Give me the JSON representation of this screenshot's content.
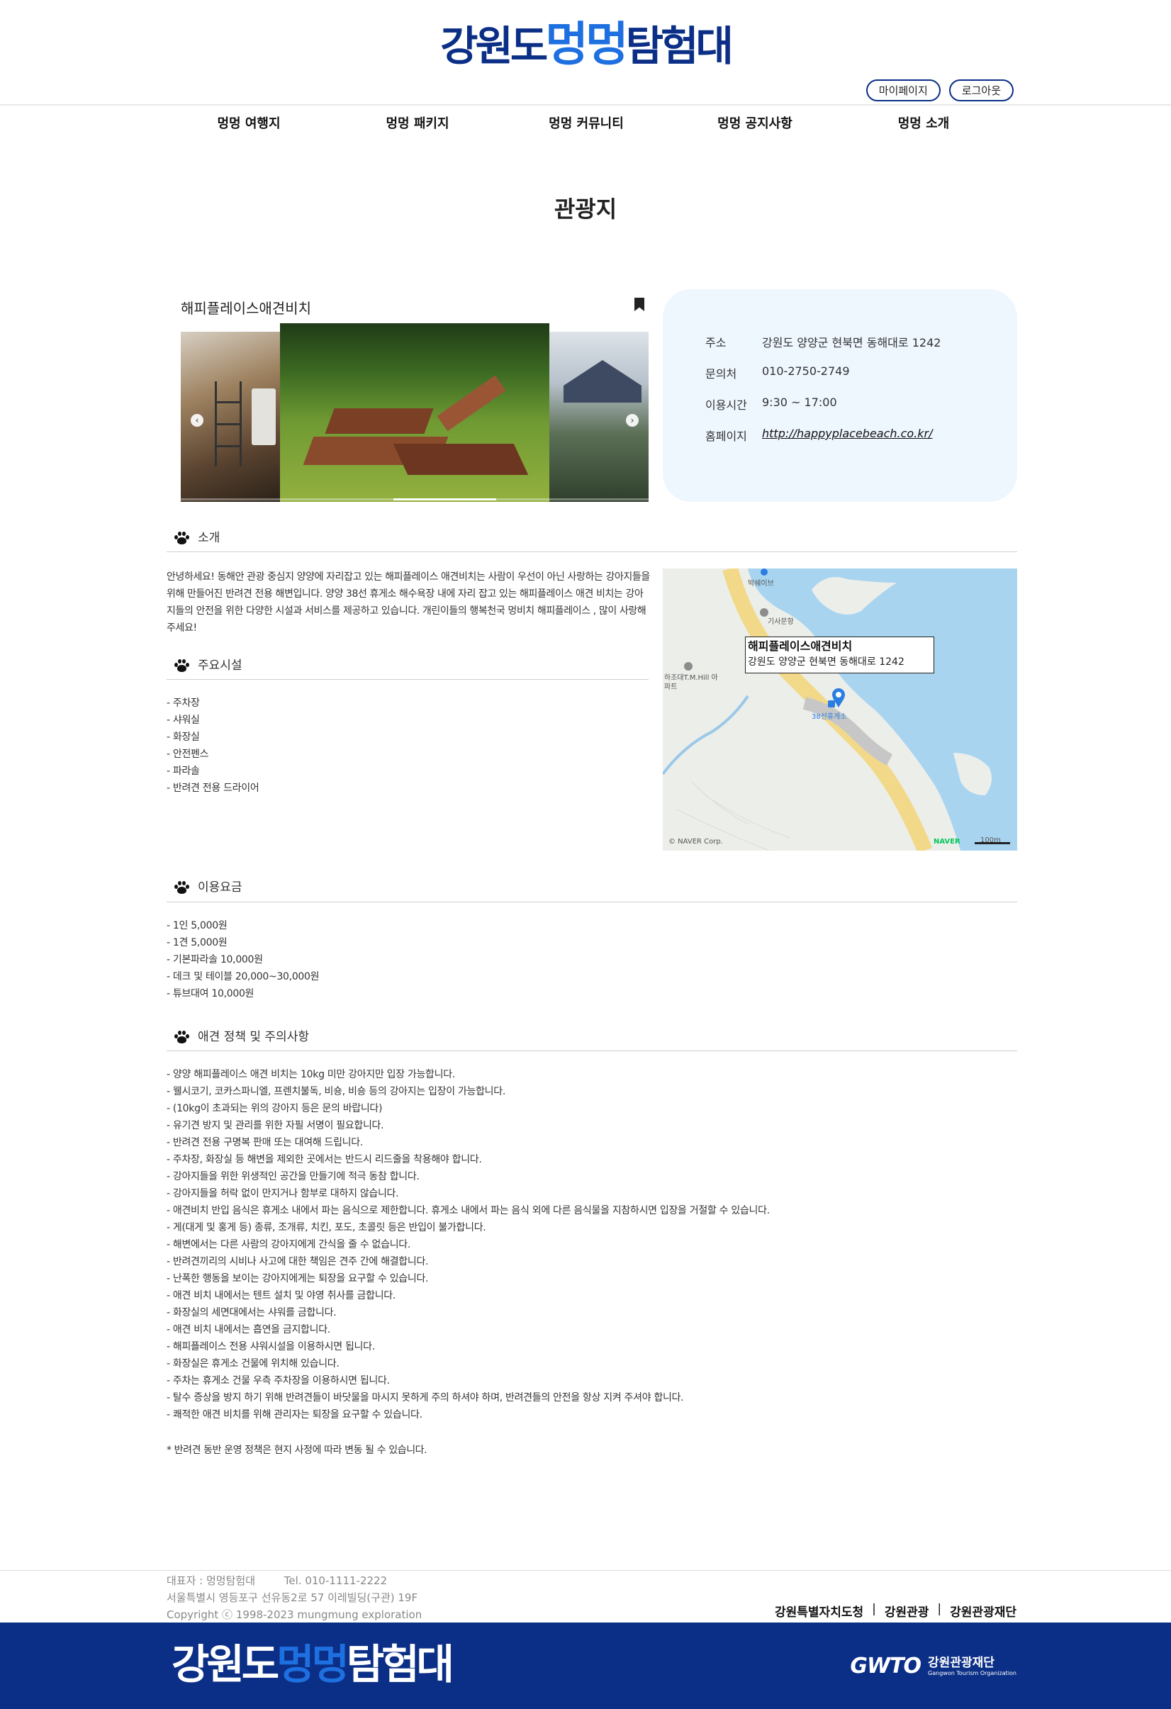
{
  "header": {
    "logo": {
      "part1": "강원도",
      "part2": "멍멍",
      "part3": "탐험대"
    },
    "mypage_label": "마이페이지",
    "logout_label": "로그아웃"
  },
  "nav": [
    "멍멍 여행지",
    "멍멍 패키지",
    "멍멍 커뮤니티",
    "멍멍 공지사항",
    "멍멍 소개"
  ],
  "page_title": "관광지",
  "place": {
    "name": "해피플레이스애견비치",
    "slider_progress": 0.33,
    "info": [
      {
        "label": "주소",
        "value": "강원도 양양군 현북면 동해대로 1242"
      },
      {
        "label": "문의처",
        "value": "010-2750-2749"
      },
      {
        "label": "이용시간",
        "value": "9:30 ~ 17:00"
      },
      {
        "label": "홈페이지",
        "value": "http://happyplacebeach.co.kr/"
      }
    ]
  },
  "intro": {
    "title": "소개",
    "text": "안녕하세요! 동해안 관광 중심지 양양에 자리잡고 있는 해피플레이스 애견비치는 사람이 우선이 아닌 사랑하는 강아지들을 위해 만들어진 반려견 전용 해변입니다. 양양 38선 휴게소 해수욕장 내에 자리 잡고 있는 해피플레이스 애견 비치는 강아지들의 안전을 위한 다양한 시설과 서비스를 제공하고 있습니다. 개린이들의 행복천국 멍비치 해피플레이스 , 많이 사랑해주세요!"
  },
  "facilities": {
    "title": "주요시설",
    "items": [
      "- 주차장",
      "- 샤워실",
      "- 화장실",
      "- 안전펜스",
      "- 파라솔",
      "- 반려견 전용 드라이어"
    ]
  },
  "map": {
    "tip_name": "해피플레이스애견비치",
    "tip_address": "강원도 양양군 현북면 동해대로 1242",
    "labels": [
      "박쉐이브",
      "기사문항",
      "하조대T.M.Hill 아파트",
      "38선휴게소"
    ],
    "credit": "© NAVER Corp.",
    "brand": "NAVER",
    "scale": "100m"
  },
  "fees": {
    "title": "이용요금",
    "items": [
      "- 1인 5,000원",
      "- 1견 5,000원",
      "- 기본파라솔 10,000원",
      "- 데크 및 테이블 20,000~30,000원",
      "- 튜브대여 10,000원"
    ]
  },
  "policy": {
    "title": "애견 정책 및 주의사항",
    "items": [
      "- 양양 해피플레이스 애견 비치는 10kg 미만 강아지만 입장 가능합니다.",
      "- 웰시코기, 코카스파니엘, 프렌치불독, 비숑, 비숑 등의 강아지는 입장이 가능합니다.",
      "- (10kg이 초과되는 위의 강아지 등은 문의 바랍니다)",
      "- 유기견 방지 및 관리를 위한 자필 서명이 필요합니다.",
      "- 반려견 전용 구명복 판매 또는 대여해 드립니다.",
      "- 주차장, 화장실 등 해변을 제외한 곳에서는 반드시 리드줄을 착용해야 합니다.",
      "- 강아지들을 위한 위생적인 공간을 만들기에 적극 동참 합니다.",
      "- 강아지들을 허락 없이 만지거나 함부로 대하지 않습니다.",
      "- 애견비치 반입 음식은 휴게소 내에서 파는 음식으로 제한합니다. 휴게소 내에서 파는 음식 외에 다른 음식물을 지참하시면 입장을 거절할 수 있습니다.",
      "- 게(대게 및 홍게 등) 종류, 조개류, 치킨, 포도, 초콜릿 등은 반입이 불가합니다.",
      "- 해변에서는 다른 사람의 강아지에게 간식을 줄 수 없습니다.",
      "- 반려견끼리의 시비나 사고에 대한 책임은 견주 간에 해결합니다.",
      "- 난폭한 행동을 보이는 강아지에게는 퇴장을 요구할 수 있습니다.",
      "- 애견 비치 내에서는 텐트 설치 및 야영 취사를 금합니다.",
      "- 화장실의 세면대에서는 샤워를 금합니다.",
      "- 애견 비치 내에서는 흡연을 금지합니다.",
      "- 해피플레이스 전용 샤워시설을 이용하시면 됩니다.",
      "- 화장실은 휴게소 건물에 위치해 있습니다.",
      "- 주차는 휴게소 건물 우측 주차장을 이용하시면 됩니다.",
      "- 탈수 증상을 방지 하기 위해 반려견들이 바닷물을 마시지 못하게 주의 하셔야 하며, 반려견들의 안전을 항상 지켜 주셔야 합니다.",
      "- 쾌적한 애견 비치를 위해 관리자는 퇴장을 요구할 수 있습니다."
    ],
    "note": "* 반려견 동반 운영 정책은 현지 사정에 따라 변동 될 수 있습니다."
  },
  "footer": {
    "rep": "대표자 : 멍멍탐험대",
    "tel": "Tel. 010-1111-2222",
    "address": "서울특별시 영등포구 선유동2로 57 이레빌딩(구관) 19F",
    "copyright": "Copyright ⓒ 1998-2023 mungmung exploration",
    "partners": [
      "강원특별자치도청",
      "강원관광",
      "강원관광재단"
    ],
    "gwto_mark": "GWTO",
    "gwto_name": "강원관광재단",
    "gwto_en": "Gangwon Tourism Organization"
  },
  "colors": {
    "brand_dark": "#0b2f86",
    "brand_light": "#1e6fe0",
    "info_bg": "#eef6fe"
  }
}
